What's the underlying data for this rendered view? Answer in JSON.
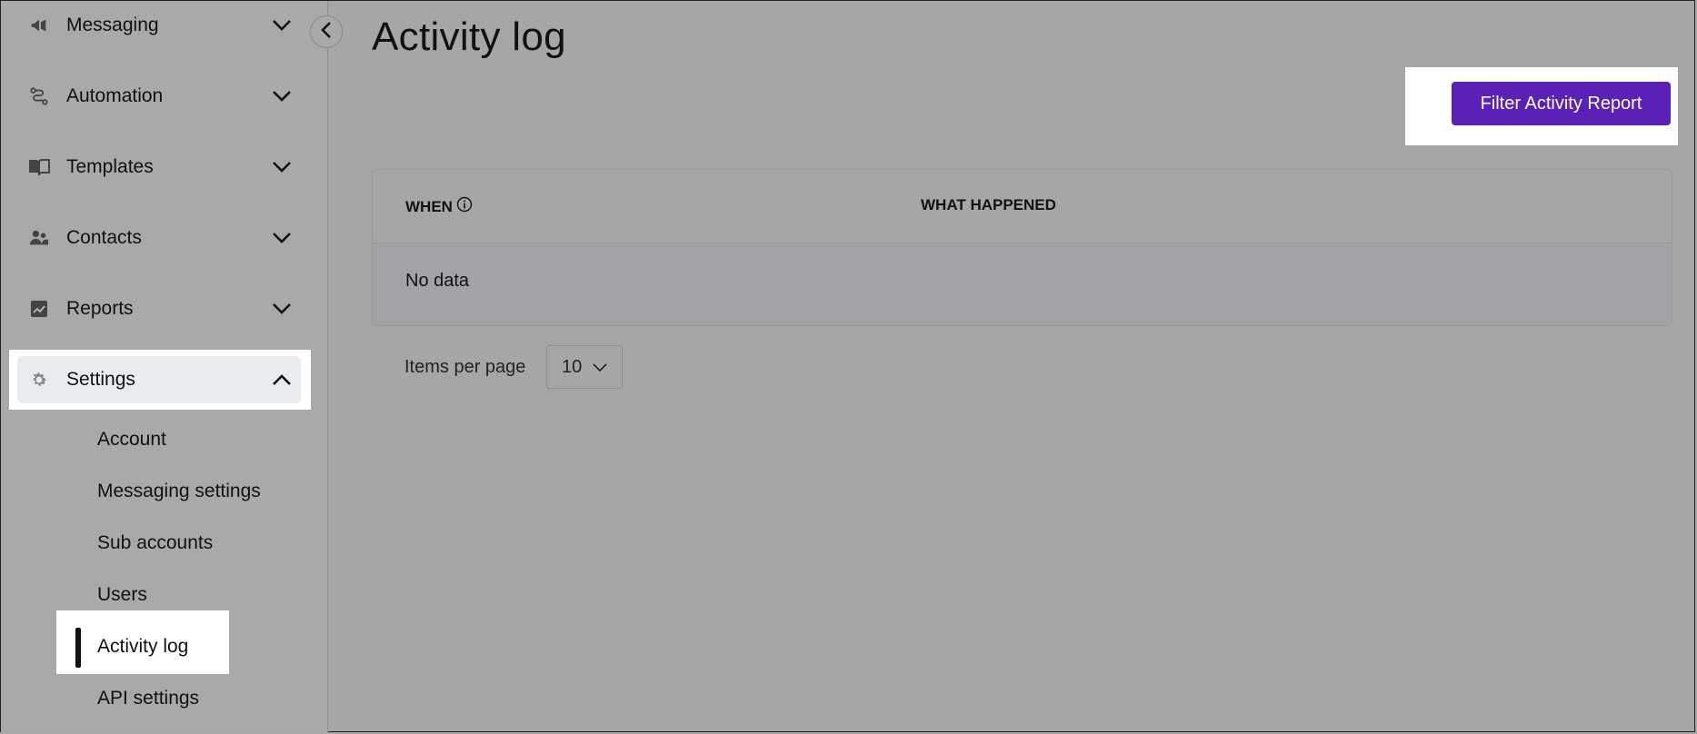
{
  "sidebar": {
    "items": [
      {
        "label": "Messaging",
        "icon": "megaphone-icon"
      },
      {
        "label": "Automation",
        "icon": "flow-icon"
      },
      {
        "label": "Templates",
        "icon": "book-icon"
      },
      {
        "label": "Contacts",
        "icon": "people-icon"
      },
      {
        "label": "Reports",
        "icon": "chart-icon"
      },
      {
        "label": "Settings",
        "icon": "gear-icon"
      }
    ],
    "settings_sub": [
      {
        "label": "Account"
      },
      {
        "label": "Messaging settings"
      },
      {
        "label": "Sub accounts"
      },
      {
        "label": "Users"
      },
      {
        "label": "Activity log"
      },
      {
        "label": "API settings"
      }
    ]
  },
  "main": {
    "title": "Activity log",
    "filter_button": "Filter Activity Report",
    "table": {
      "headers": [
        "WHEN",
        "WHAT HAPPENED"
      ],
      "empty_text": "No data"
    },
    "pager": {
      "label": "Items per page",
      "value": "10"
    }
  },
  "colors": {
    "accent": "#5b21b6"
  }
}
